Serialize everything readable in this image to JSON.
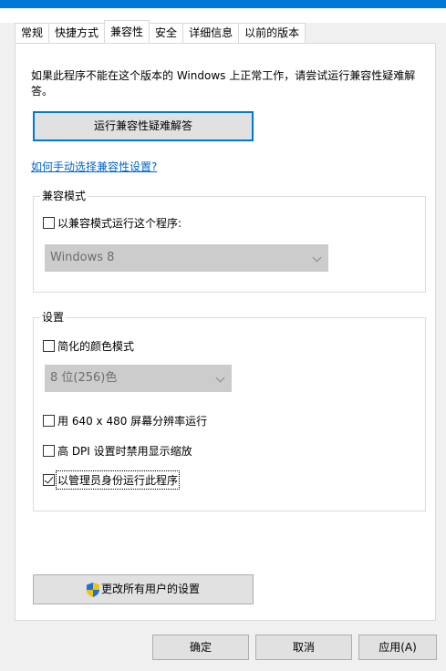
{
  "tabs": [
    "常规",
    "快捷方式",
    "兼容性",
    "安全",
    "详细信息",
    "以前的版本"
  ],
  "active_tab": "兼容性",
  "intro_text": "如果此程序不能在这个版本的 Windows 上正常工作，请尝试运行兼容性疑难解答。",
  "troubleshoot_button": "运行兼容性疑难解答",
  "manual_link": "如何手动选择兼容性设置?",
  "compat_mode": {
    "legend": "兼容模式",
    "checkbox_label": "以兼容模式运行这个程序:",
    "checked": false,
    "os_select_value": "Windows 8"
  },
  "settings": {
    "legend": "设置",
    "reduced_color": {
      "label": "简化的颜色模式",
      "checked": false
    },
    "color_select_value": "8 位(256)色",
    "run_640x480": {
      "label": "用 640 x 480 屏幕分辨率运行",
      "checked": false
    },
    "high_dpi": {
      "label": "高 DPI 设置时禁用显示缩放",
      "checked": false
    },
    "run_as_admin": {
      "label": "以管理员身份运行此程序",
      "checked": true
    }
  },
  "all_users_button": "更改所有用户的设置",
  "footer": {
    "ok": "确定",
    "cancel": "取消",
    "apply": "应用(A)"
  },
  "colors": {
    "accent": "#0078d7",
    "link": "#0066cc",
    "disabled_field": "#cccccc",
    "button_face": "#e1e1e1"
  }
}
